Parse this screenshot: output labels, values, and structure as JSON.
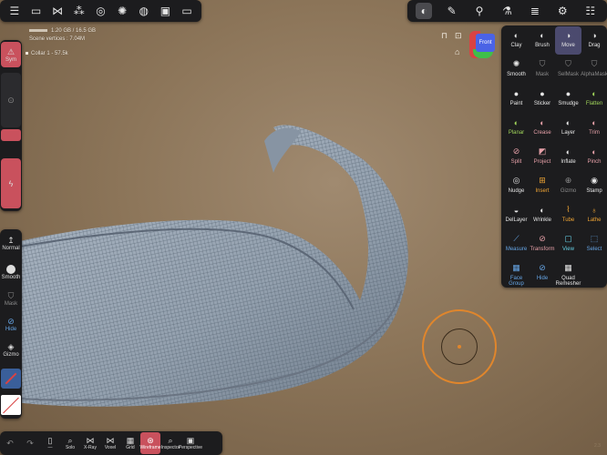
{
  "top_left_icons": [
    "menu-icon",
    "folder-icon",
    "share-icon",
    "scene-icon",
    "globe-icon",
    "sun-icon",
    "material-icon",
    "image-icon",
    "camera-icon"
  ],
  "top_right_icons": [
    "avatar-icon",
    "pen-icon",
    "dropper-icon",
    "flask-icon",
    "stack-icon",
    "gear-icon",
    "sliders-icon"
  ],
  "stats": {
    "memory": "1.20 GB / 16.5 GB",
    "vertices": "Scene vertices : 7.04M",
    "object": "Collar 1 - 57.5k"
  },
  "view_cube": {
    "label": "Front"
  },
  "sidebar": {
    "sym": "Sym",
    "normal": "Normal",
    "smooth": "Smooth",
    "mask": "Mask",
    "hide": "Hide",
    "gizmo": "Gizmo"
  },
  "tools": [
    {
      "label": "Clay",
      "color": "#e6e6e6",
      "icon": "clay-icon"
    },
    {
      "label": "Brush",
      "color": "#e6e6e6",
      "icon": "brush-icon"
    },
    {
      "label": "Move",
      "color": "#e6e6e6",
      "icon": "move-icon",
      "selected": true
    },
    {
      "label": "Drag",
      "color": "#e6e6e6",
      "icon": "drag-icon"
    },
    {
      "label": "Smooth",
      "color": "#e6e6e6",
      "icon": "smooth-icon"
    },
    {
      "label": "Mask",
      "color": "#8c8c8c",
      "icon": "mask-icon"
    },
    {
      "label": "SelMask",
      "color": "#8c8c8c",
      "icon": "selmask-icon"
    },
    {
      "label": "AlphaMask",
      "color": "#8c8c8c",
      "icon": "alphamask-icon"
    },
    {
      "label": "Paint",
      "color": "#e6e6e6",
      "icon": "paint-icon"
    },
    {
      "label": "Sticker",
      "color": "#e6e6e6",
      "icon": "sticker-icon"
    },
    {
      "label": "Smudge",
      "color": "#e6e6e6",
      "icon": "smudge-icon"
    },
    {
      "label": "Flatten",
      "color": "#9fd35a",
      "icon": "flatten-icon"
    },
    {
      "label": "Planar",
      "color": "#9fd35a",
      "icon": "planar-icon"
    },
    {
      "label": "Crease",
      "color": "#e6a0a8",
      "icon": "crease-icon"
    },
    {
      "label": "Layer",
      "color": "#e6e6e6",
      "icon": "layer-icon"
    },
    {
      "label": "Trim",
      "color": "#e6a0a8",
      "icon": "trim-icon"
    },
    {
      "label": "Split",
      "color": "#e6a0a8",
      "icon": "split-icon"
    },
    {
      "label": "Project",
      "color": "#e6a0a8",
      "icon": "project-icon"
    },
    {
      "label": "Inflate",
      "color": "#e6e6e6",
      "icon": "inflate-icon"
    },
    {
      "label": "Pinch",
      "color": "#e6a0a8",
      "icon": "pinch-icon"
    },
    {
      "label": "Nudge",
      "color": "#e6e6e6",
      "icon": "nudge-icon"
    },
    {
      "label": "Insert",
      "color": "#f0a534",
      "icon": "insert-icon"
    },
    {
      "label": "Gizmo",
      "color": "#8c8c8c",
      "icon": "gizmo-tool-icon"
    },
    {
      "label": "Stamp",
      "color": "#e6e6e6",
      "icon": "stamp-icon"
    },
    {
      "label": "DelLayer",
      "color": "#e6e6e6",
      "icon": "dellayer-icon"
    },
    {
      "label": "Wrinkle",
      "color": "#e6e6e6",
      "icon": "wrinkle-icon"
    },
    {
      "label": "Tube",
      "color": "#f0a534",
      "icon": "tube-icon"
    },
    {
      "label": "Lathe",
      "color": "#f0a534",
      "icon": "lathe-icon"
    },
    {
      "label": "Measure",
      "color": "#66a6e6",
      "icon": "measure-icon"
    },
    {
      "label": "Transform",
      "color": "#e6a0a8",
      "icon": "transform-icon"
    },
    {
      "label": "View",
      "color": "#66d0e6",
      "icon": "view-icon"
    },
    {
      "label": "Select",
      "color": "#66a6e6",
      "icon": "select-icon"
    },
    {
      "label": "Face Group",
      "color": "#66a6e6",
      "icon": "facegroup-icon"
    },
    {
      "label": "Hide",
      "color": "#66a6e6",
      "icon": "hide-tool-icon"
    },
    {
      "label": "Quad Remesher",
      "color": "#e6e6e6",
      "icon": "quadremesher-icon"
    }
  ],
  "bottom": [
    {
      "label": "",
      "icon": "undo-icon"
    },
    {
      "label": "",
      "icon": "redo-icon"
    },
    {
      "label": "—",
      "icon": "phone-icon"
    },
    {
      "label": "Solo",
      "icon": "search-icon"
    },
    {
      "label": "X-Ray",
      "icon": "xray-icon"
    },
    {
      "label": "Voxel",
      "icon": "voxel-icon"
    },
    {
      "label": "Grid",
      "icon": "grid-icon"
    },
    {
      "label": "Wireframe",
      "icon": "wireframe-icon",
      "active": true
    },
    {
      "label": "Inspector",
      "icon": "inspector-icon"
    },
    {
      "label": "Perspective",
      "icon": "perspective-icon"
    }
  ],
  "version": "2.3"
}
